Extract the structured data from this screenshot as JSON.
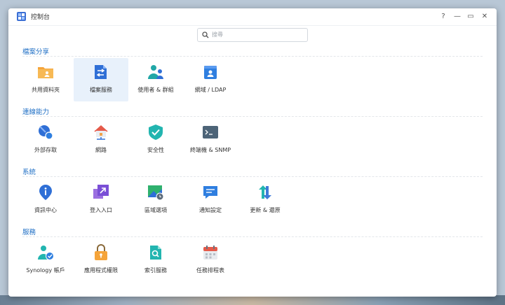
{
  "window": {
    "title": "控制台",
    "controls": {
      "help": "?",
      "minimize": "—",
      "maximize": "▭",
      "close": "✕"
    }
  },
  "search": {
    "placeholder": "搜尋"
  },
  "sections": [
    {
      "title": "檔案分享",
      "items": [
        {
          "label": "共用資料夾",
          "icon": "shared-folder-icon"
        },
        {
          "label": "檔案服務",
          "icon": "file-services-icon",
          "selected": true
        },
        {
          "label": "使用者 & 群組",
          "icon": "users-groups-icon"
        },
        {
          "label": "網域 / LDAP",
          "icon": "domain-ldap-icon"
        }
      ]
    },
    {
      "title": "連線能力",
      "items": [
        {
          "label": "外部存取",
          "icon": "external-access-icon"
        },
        {
          "label": "網路",
          "icon": "network-icon"
        },
        {
          "label": "安全性",
          "icon": "security-shield-icon"
        },
        {
          "label": "終端機 & SNMP",
          "icon": "terminal-icon"
        }
      ]
    },
    {
      "title": "系統",
      "items": [
        {
          "label": "資訊中心",
          "icon": "info-center-icon"
        },
        {
          "label": "登入入口",
          "icon": "login-portal-icon"
        },
        {
          "label": "區域選項",
          "icon": "regional-options-icon"
        },
        {
          "label": "通知設定",
          "icon": "notification-icon"
        },
        {
          "label": "更新 & 還原",
          "icon": "update-restore-icon"
        }
      ]
    },
    {
      "title": "服務",
      "items": [
        {
          "label": "Synology 帳戶",
          "icon": "synology-account-icon"
        },
        {
          "label": "應用程式權限",
          "icon": "app-privileges-icon"
        },
        {
          "label": "索引服務",
          "icon": "indexing-service-icon"
        },
        {
          "label": "任務排程表",
          "icon": "task-scheduler-icon"
        }
      ]
    }
  ],
  "colors": {
    "accent": "#1f6fc5",
    "selected_bg": "#e8f1fb"
  }
}
